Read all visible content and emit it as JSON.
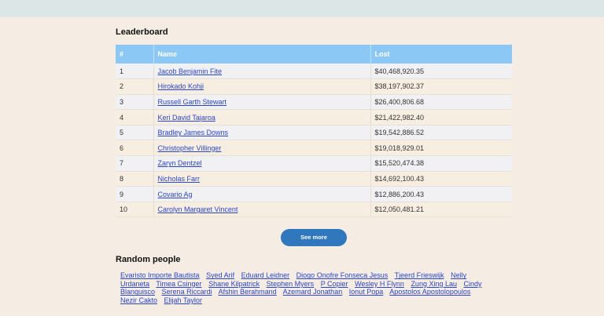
{
  "leaderboard": {
    "title": "Leaderboard",
    "headers": {
      "rank": "#",
      "name": "Name",
      "lost": "Lost"
    },
    "rows": [
      {
        "rank": "1",
        "name": "Jacob Benjamin Fite",
        "lost": "$40,468,920.35"
      },
      {
        "rank": "2",
        "name": "Hirokado Kohji",
        "lost": "$38,197,902.37"
      },
      {
        "rank": "3",
        "name": "Russell Garth Stewart",
        "lost": "$26,400,806.68"
      },
      {
        "rank": "4",
        "name": "Keri David Tajaroa",
        "lost": "$21,422,982.40"
      },
      {
        "rank": "5",
        "name": "Bradley James Downs",
        "lost": "$19,542,886.52"
      },
      {
        "rank": "6",
        "name": "Christopher Villinger",
        "lost": "$19,018,929.01"
      },
      {
        "rank": "7",
        "name": "Zaryn Dentzel",
        "lost": "$15,520,474.38"
      },
      {
        "rank": "8",
        "name": "Nicholas Farr",
        "lost": "$14,692,100.43"
      },
      {
        "rank": "9",
        "name": "Covario Ag",
        "lost": "$12,886,200.43"
      },
      {
        "rank": "10",
        "name": "Carolyn Margaret Vincent",
        "lost": "$12,050,481.21"
      }
    ],
    "see_more_label": "See more"
  },
  "random_people": {
    "title": "Random people",
    "names": [
      "Evaristo Importe Bautista",
      "Syed Arif",
      "Eduard Leidner",
      "Diogo Onofre Fonseca Jesus",
      "Tjeerd Frieswijk",
      "Nelly Urdaneta",
      "Timea Csinger",
      "Shane Kilpatrick",
      "Stephen Myers",
      "P Copier",
      "Wesley H Flynn",
      "Zung Xing Lau",
      "Cindy Blanquisco",
      "Serena Riccardi",
      "Afshin Berahmand",
      "Azemard Jonathan",
      "Ionut Popa",
      "Apostolos Apostolopoulos",
      "Nezir Cakto",
      "Elijah Taylor"
    ]
  }
}
